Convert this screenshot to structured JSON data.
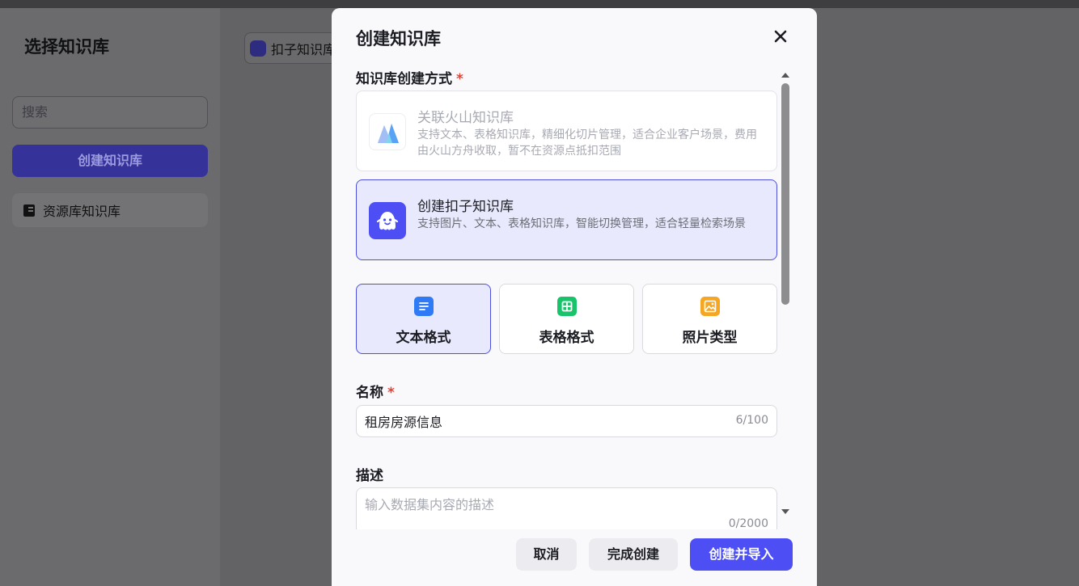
{
  "background": {
    "panel_title": "选择知识库",
    "search_placeholder": "搜索",
    "create_button": "创建知识库",
    "resource_item": "资源库知识库",
    "chip_label": "扣子知识库"
  },
  "modal": {
    "title": "创建知识库",
    "creation_method_label": "知识库创建方式",
    "required_mark": "*",
    "options": [
      {
        "title": "关联火山知识库",
        "description": "支持文本、表格知识库，精细化切片管理，适合企业客户场景，费用由火山方舟收取，暂不在资源点抵扣范围",
        "state": "disabled",
        "icon": "volcano-icon"
      },
      {
        "title": "创建扣子知识库",
        "description": "支持图片、文本、表格知识库，智能切换管理，适合轻量检索场景",
        "state": "selected",
        "icon": "coze-ghost-icon"
      }
    ],
    "formats": [
      {
        "label": "文本格式",
        "icon": "text-doc-icon",
        "color": "#2f7bf5",
        "active": true
      },
      {
        "label": "表格格式",
        "icon": "table-icon",
        "color": "#18c46a",
        "active": false
      },
      {
        "label": "照片类型",
        "icon": "image-icon",
        "color": "#f5a623",
        "active": false
      }
    ],
    "name_label": "名称",
    "name_value": "租房房源信息",
    "name_count": "6/100",
    "desc_label": "描述",
    "desc_placeholder": "输入数据集内容的描述",
    "desc_count": "0/2000",
    "footer": {
      "cancel": "取消",
      "finish": "完成创建",
      "create_import": "创建并导入"
    }
  },
  "colors": {
    "accent": "#4d4ff4",
    "selected_bg": "#e8e9fc",
    "required": "#f03d30"
  }
}
